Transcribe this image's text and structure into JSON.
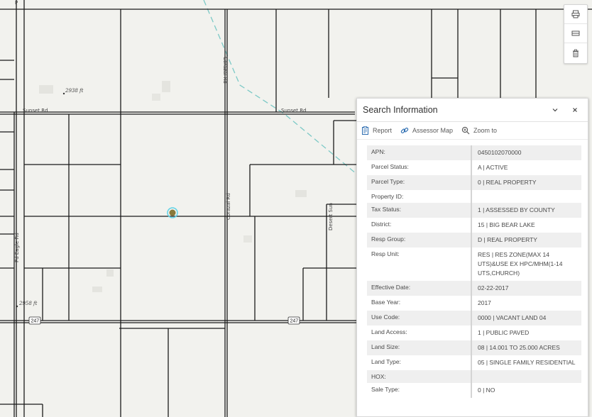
{
  "map": {
    "road_labels": {
      "sunset_left": "Sunset Rd",
      "sunset_right": "Sunset Rd",
      "corazal": "Corazal Rd",
      "desert_sun": "Desert Sun",
      "left_vertical": "Pd Eagle Rd",
      "top_partial": "P"
    },
    "elevations": {
      "a": "2938 ft",
      "b": "2958 ft"
    },
    "shields": {
      "left": "247",
      "right": "247"
    }
  },
  "tools": [
    {
      "name": "print-tool",
      "icon": "printer-icon"
    },
    {
      "name": "layers-tool",
      "icon": "layers-icon"
    },
    {
      "name": "clear-tool",
      "icon": "trash-icon"
    }
  ],
  "panel": {
    "title": "Search Information",
    "actions": {
      "report": "Report",
      "assessor_map": "Assessor Map",
      "zoom_to": "Zoom to"
    },
    "colors": {
      "accent": "#2b6cb0"
    },
    "rows": [
      {
        "key": "APN:",
        "value": "0450102070000"
      },
      {
        "key": "Parcel Status:",
        "value": "A | ACTIVE"
      },
      {
        "key": "Parcel Type:",
        "value": "0 | REAL PROPERTY"
      },
      {
        "key": "Property ID:",
        "value": ""
      },
      {
        "key": "Tax Status:",
        "value": "1 | ASSESSED BY COUNTY"
      },
      {
        "key": "District:",
        "value": "15 | BIG BEAR LAKE"
      },
      {
        "key": "Resp Group:",
        "value": "D | REAL PROPERTY"
      },
      {
        "key": "Resp Unit:",
        "value": "RES | RES ZONE(MAX 14 UTS)&USE EX HPC/MHM(1-14 UTS,CHURCH)"
      },
      {
        "key": "Effective Date:",
        "value": "02-22-2017"
      },
      {
        "key": "Base Year:",
        "value": "2017"
      },
      {
        "key": "Use Code:",
        "value": "0000 | VACANT LAND 04"
      },
      {
        "key": "Land Access:",
        "value": "1 | PUBLIC PAVED"
      },
      {
        "key": "Land Size:",
        "value": "08 | 14.001 TO 25.000 ACRES"
      },
      {
        "key": "Land Type:",
        "value": "05 | SINGLE FAMILY RESIDENTIAL"
      },
      {
        "key": "HOX:",
        "value": ""
      },
      {
        "key": "Sale Type:",
        "value": "0 | NO"
      }
    ]
  }
}
